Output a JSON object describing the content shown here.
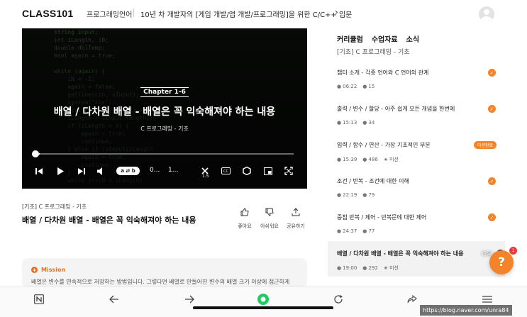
{
  "header": {
    "logo": "CLASS101",
    "category": "프로그래밍언어",
    "course_title": "10년 차 개발자의 [게임 개발/앱 개발/프로그래밍]을 위한 C/C++ 입문",
    "chevron_icon": "chevron-right-icon",
    "avatar_icon": "user-avatar-icon"
  },
  "video": {
    "chapter": "Chapter 1-6",
    "title": "배열 / 다차원 배열 - 배열은 꼭 익숙해져야 하는 내용",
    "subtitle": "C 프로그래밍 - 기초",
    "progress": 0.02,
    "controls": {
      "loop_label": "a ⇄ b",
      "time_current": "0...",
      "time_total": "1...",
      "speed_label": "1.5",
      "cc_label": "CC"
    }
  },
  "lesson": {
    "breadcrumb": "[기초] C 프로그래밍 - 기초",
    "title": "배열 / 다차원 배열 - 배열은 꼭 익숙해져야 하는 내용",
    "actions": [
      {
        "label": "좋아요"
      },
      {
        "label": "아쉬워요"
      },
      {
        "label": "공유하기"
      }
    ]
  },
  "mission": {
    "title": "Mission",
    "text": "배열은 변수를 연속적으로 저장하는 방법입니다. 그렇다면 배열로 만들어진 변수의 배열 크기 이상에 접근하게"
  },
  "sidebar": {
    "tabs": [
      "커리큘럼",
      "수업자료",
      "소식"
    ],
    "section_title": "[기초] C 프로그래밍 - 기초",
    "items": [
      {
        "title": "챕터 소개 - 각종 언어와 C 언어의 관계",
        "duration": "06:22",
        "count": "15",
        "status": "done"
      },
      {
        "title": "출력 / 변수 / 할당 - 아주 쉽게 모든 개념을 한번에",
        "duration": "15:13",
        "count": "34",
        "status": "done"
      },
      {
        "title": "입력 / 함수 / 연산 - 가장 기초적인 부분",
        "duration": "15:39",
        "count": "486",
        "mission": "미션",
        "badge": "미션완료",
        "status": "badge"
      },
      {
        "title": "조건 / 반복 - 조건에 대한 이해",
        "duration": "22:19",
        "count": "79",
        "status": "done"
      },
      {
        "title": "중첩 반복 / 제어 - 반복문에 대한 제어",
        "duration": "24:37",
        "count": "77",
        "status": "done"
      },
      {
        "title": "배열 / 다차원 배열 - 배열은 꼭 익숙해져야 하는 내용",
        "duration": "19:00",
        "count": "292",
        "mission": "미션",
        "badge": "미션",
        "status": "playing"
      }
    ]
  },
  "help": {
    "label": "?",
    "count": "1"
  },
  "watermark": "https://blog.naver.com/unra84"
}
